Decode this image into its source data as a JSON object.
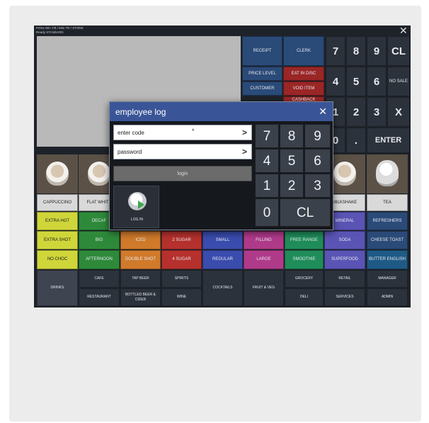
{
  "header": {
    "line1": "POSx Win 7/8 / Mini TR / STORE",
    "line2": "Ready  STANDARD"
  },
  "top_buttons": {
    "receipt": "RECEIPT",
    "clerk": "CLERK",
    "price_level": "PRICE LEVEL",
    "eat_in": "EAT IN DISC",
    "customer": "CUSTOMER",
    "void_item": "VOID ITEM",
    "cashback": "CASHBACK"
  },
  "main_keypad": {
    "k7": "7",
    "k8": "8",
    "k9": "9",
    "cl": "CL",
    "k4": "4",
    "k5": "5",
    "k6": "6",
    "no_sale": "NO SALE",
    "k1": "1",
    "k2": "2",
    "k3": "3",
    "x": "X",
    "k0": "0",
    "dot": ".",
    "enter": "ENTER"
  },
  "categories": {
    "row_a": [
      "CAPPUCCINO",
      "FLAT WHITE",
      "",
      "",
      "",
      "",
      "",
      "MILKSHAKE",
      "TEA"
    ],
    "row_b": [
      "EXTRA HOT",
      "DECAF",
      "",
      "",
      "",
      "",
      "",
      "MINERAL",
      "REFRESHERS"
    ],
    "row_c": [
      "EXTRA SHOT",
      "BIG",
      "ICED",
      "2 SUGAR",
      "SMALL",
      "FILLING",
      "FREE RANGE",
      "SODA",
      "CHEESE TOAST"
    ],
    "row_d": [
      "NO CHOC",
      "AFTERNOON",
      "DOUBLE SHOT",
      "4 SUGAR",
      "REGULAR",
      "LARGE",
      "SMOOTHIE",
      "SUPERFOOD",
      "BUTTER ENGLISH"
    ]
  },
  "bottom_nav": {
    "drinks": "DRINKS",
    "cafe": "CAFE",
    "restaurant": "RESTAURANT",
    "tap_beer": "TAP BEER",
    "bottled_beer": "BOTTLED BEER & CIDER",
    "spirits": "SPIRITS",
    "wine": "WINE",
    "cocktails": "COCKTAILS",
    "fruit_veg": "FRUIT & VEG",
    "grocery": "GROCERY",
    "deli": "DELI",
    "retail": "RETAIL",
    "services": "SERVICES",
    "manager": "MANAGER",
    "admin": "ADMIN"
  },
  "employee_log": {
    "title": "employee log",
    "enter_code_label": "enter code",
    "code_mask": "*",
    "password_label": "password",
    "login_bar": "login",
    "log_in_label": "LOG IN",
    "keypad": [
      "7",
      "8",
      "9",
      "4",
      "5",
      "6",
      "1",
      "2",
      "3",
      "0",
      "CL"
    ]
  },
  "colors": {
    "modal_title": "#3a5597",
    "blue_button": "#2a4a78",
    "yellow": "#cfd63a",
    "green": "#2e8a3a",
    "orange": "#d07a2a",
    "red": "#b6312d",
    "purple": "#7a3a9a",
    "magenta": "#b03a8a",
    "teal": "#1f8d86"
  }
}
